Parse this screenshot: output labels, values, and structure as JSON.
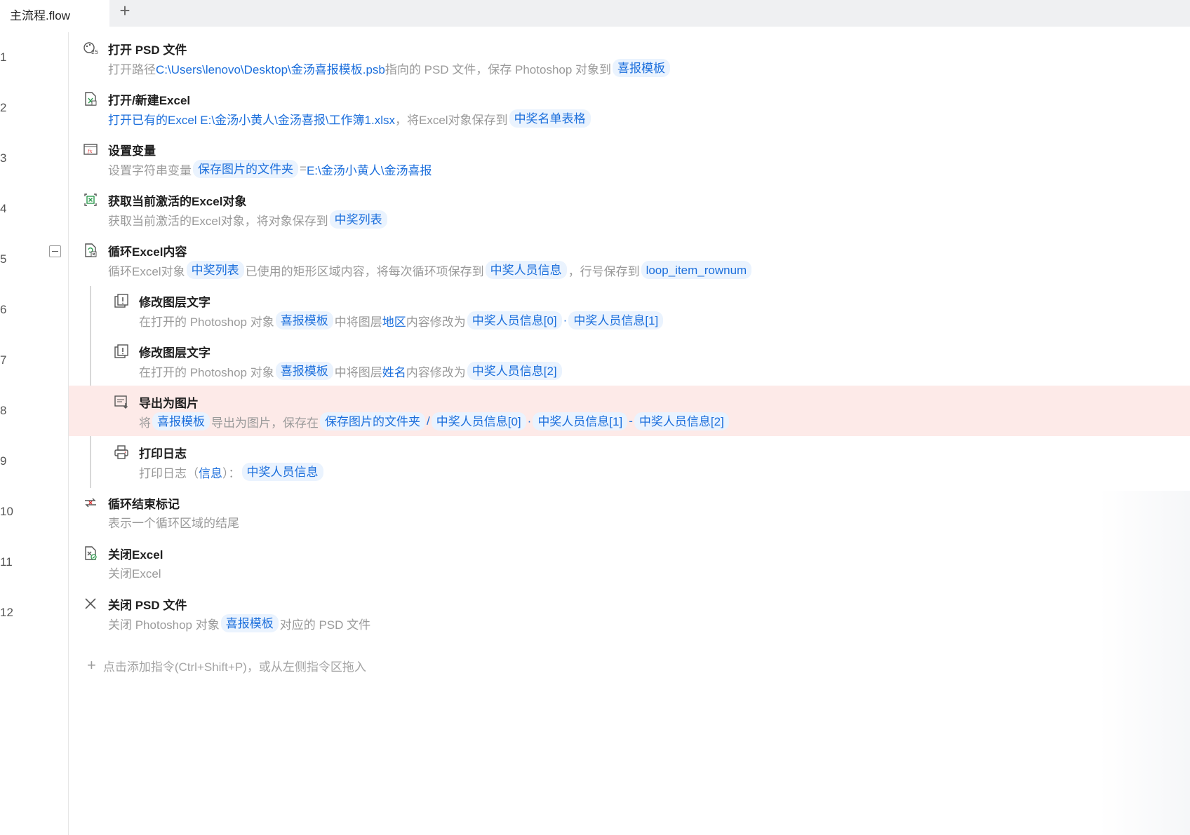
{
  "tabs": {
    "active": "主流程.flow",
    "add": "+"
  },
  "add_hint": {
    "plus": "+",
    "text": "点击添加指令(Ctrl+Shift+P)，或从左侧指令区拖入"
  },
  "steps": [
    {
      "num": "1",
      "title": "打开 PSD 文件",
      "icon": "photoshop-icon",
      "desc": [
        {
          "k": "t",
          "s": "打开路径 "
        },
        {
          "k": "v",
          "s": "C:\\Users\\lenovo\\Desktop\\金汤喜报模板.psb"
        },
        {
          "k": "t",
          "s": " 指向的 PSD 文件，保存 Photoshop 对象到 "
        },
        {
          "k": "chip",
          "s": "喜报模板"
        }
      ]
    },
    {
      "num": "2",
      "title": "打开/新建Excel",
      "icon": "excel-open-icon",
      "desc": [
        {
          "k": "v",
          "s": "打开已有的Excel E:\\金汤小黄人\\金汤喜报\\工作簿1.xlsx"
        },
        {
          "k": "t",
          "s": "，将Excel对象保存到"
        },
        {
          "k": "chip",
          "s": "中奖名单表格"
        }
      ]
    },
    {
      "num": "3",
      "title": "设置变量",
      "icon": "variable-fx-icon",
      "desc": [
        {
          "k": "t",
          "s": "设置字符串变量"
        },
        {
          "k": "chip",
          "s": "保存图片的文件夹"
        },
        {
          "k": "t",
          "s": "="
        },
        {
          "k": "v",
          "s": "E:\\金汤小黄人\\金汤喜报"
        }
      ]
    },
    {
      "num": "4",
      "title": "获取当前激活的Excel对象",
      "icon": "excel-active-icon",
      "desc": [
        {
          "k": "t",
          "s": "获取当前激活的Excel对象，将对象保存到"
        },
        {
          "k": "chip",
          "s": "中奖列表"
        }
      ]
    },
    {
      "num": "5",
      "title": "循环Excel内容",
      "icon": "excel-loop-icon",
      "collapsible": true,
      "desc": [
        {
          "k": "t",
          "s": "循环Excel对象"
        },
        {
          "k": "chip",
          "s": "中奖列表"
        },
        {
          "k": "t",
          "s": "已使用的矩形区域内容，将每次循环项保存到"
        },
        {
          "k": "chip",
          "s": "中奖人员信息"
        },
        {
          "k": "t",
          "s": "，行号保存到"
        },
        {
          "k": "chip",
          "s": "loop_item_rownum"
        }
      ]
    },
    {
      "num": "6",
      "title": "修改图层文字",
      "icon": "layer-text-icon",
      "indent": true,
      "desc": [
        {
          "k": "t",
          "s": "在打开的 Photoshop 对象 "
        },
        {
          "k": "chip",
          "s": "喜报模板"
        },
        {
          "k": "t",
          "s": " 中将图层 "
        },
        {
          "k": "v",
          "s": "地区"
        },
        {
          "k": "t",
          "s": " 内容修改为 "
        },
        {
          "k": "chip",
          "s": "中奖人员信息[0]"
        },
        {
          "k": "v",
          "s": "·"
        },
        {
          "k": "chip",
          "s": "中奖人员信息[1]"
        }
      ]
    },
    {
      "num": "7",
      "title": "修改图层文字",
      "icon": "layer-text-icon",
      "indent": true,
      "desc": [
        {
          "k": "t",
          "s": "在打开的 Photoshop 对象 "
        },
        {
          "k": "chip",
          "s": "喜报模板"
        },
        {
          "k": "t",
          "s": " 中将图层 "
        },
        {
          "k": "v",
          "s": "姓名"
        },
        {
          "k": "t",
          "s": " 内容修改为 "
        },
        {
          "k": "chip",
          "s": "中奖人员信息[2]"
        }
      ]
    },
    {
      "num": "8",
      "title": "导出为图片",
      "icon": "export-image-icon",
      "indent": true,
      "highlight": true,
      "desc": [
        {
          "k": "t",
          "s": "将 "
        },
        {
          "k": "chip",
          "s": "喜报模板"
        },
        {
          "k": "t",
          "s": " 导出为图片，保存在 "
        },
        {
          "k": "chip",
          "s": "保存图片的文件夹"
        },
        {
          "k": "v",
          "s": " / "
        },
        {
          "k": "chip",
          "s": "中奖人员信息[0]"
        },
        {
          "k": "v",
          "s": "·"
        },
        {
          "k": "chip",
          "s": "中奖人员信息[1]"
        },
        {
          "k": "v",
          "s": " - "
        },
        {
          "k": "chip",
          "s": "中奖人员信息[2]"
        }
      ]
    },
    {
      "num": "9",
      "title": "打印日志",
      "icon": "printer-icon",
      "indent": true,
      "desc": [
        {
          "k": "t",
          "s": "打印日志（"
        },
        {
          "k": "v",
          "s": "信息"
        },
        {
          "k": "t",
          "s": "）："
        },
        {
          "k": "chip",
          "s": "中奖人员信息"
        }
      ]
    },
    {
      "num": "10",
      "title": "循环结束标记",
      "icon": "loop-end-icon",
      "desc": [
        {
          "k": "t",
          "s": "表示一个循环区域的结尾"
        }
      ]
    },
    {
      "num": "11",
      "title": "关闭Excel",
      "icon": "excel-close-icon",
      "desc": [
        {
          "k": "t",
          "s": "关闭Excel"
        }
      ]
    },
    {
      "num": "12",
      "title": "关闭 PSD 文件",
      "icon": "close-x-icon",
      "desc": [
        {
          "k": "t",
          "s": "关闭 Photoshop 对象 "
        },
        {
          "k": "chip",
          "s": "喜报模板"
        },
        {
          "k": "t",
          "s": " 对应的 PSD 文件"
        }
      ]
    }
  ]
}
